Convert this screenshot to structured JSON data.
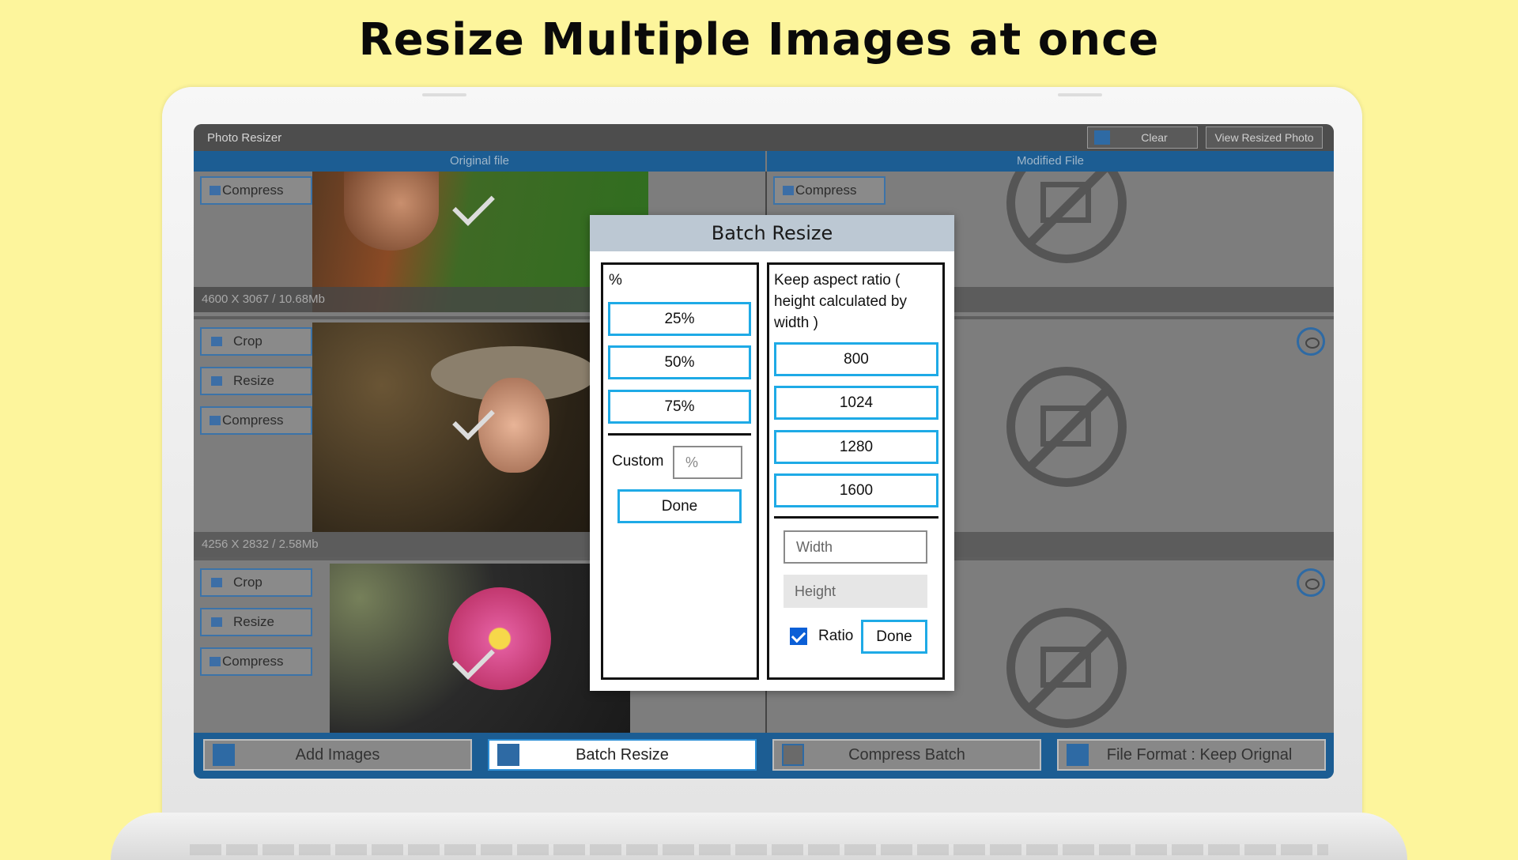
{
  "headline": "Resize Multiple Images at once",
  "window": {
    "title": "Photo Resizer",
    "clear_label": "Clear",
    "view_resized_label": "View Resized Photo"
  },
  "columns": {
    "original": "Original file",
    "modified": "Modified File"
  },
  "side_buttons": {
    "crop": "Crop",
    "resize": "Resize",
    "compress": "Compress"
  },
  "images": [
    {
      "info": "4600 X 3067 / 10.68Mb"
    },
    {
      "info": "4256 X 2832 / 2.58Mb"
    },
    {
      "info": ""
    }
  ],
  "bottom_bar": {
    "add_images": "Add Images",
    "batch_resize": "Batch Resize",
    "compress_batch": "Compress Batch",
    "file_format": "File Format : Keep Orignal"
  },
  "dialog": {
    "title": "Batch Resize",
    "percent_header": "%",
    "percent_options": [
      "25%",
      "50%",
      "75%"
    ],
    "custom_label": "Custom",
    "custom_placeholder": "%",
    "done_label": "Done",
    "aspect_text": "Keep aspect ratio ( height calculated by width )",
    "width_options": [
      "800",
      "1024",
      "1280",
      "1600"
    ],
    "width_placeholder": "Width",
    "height_placeholder": "Height",
    "ratio_label": "Ratio",
    "ratio_checked": true,
    "done_label_right": "Done"
  },
  "colors": {
    "background": "#fdf59c",
    "accent": "#1c5d93",
    "dialog_border": "#1eaae6"
  }
}
